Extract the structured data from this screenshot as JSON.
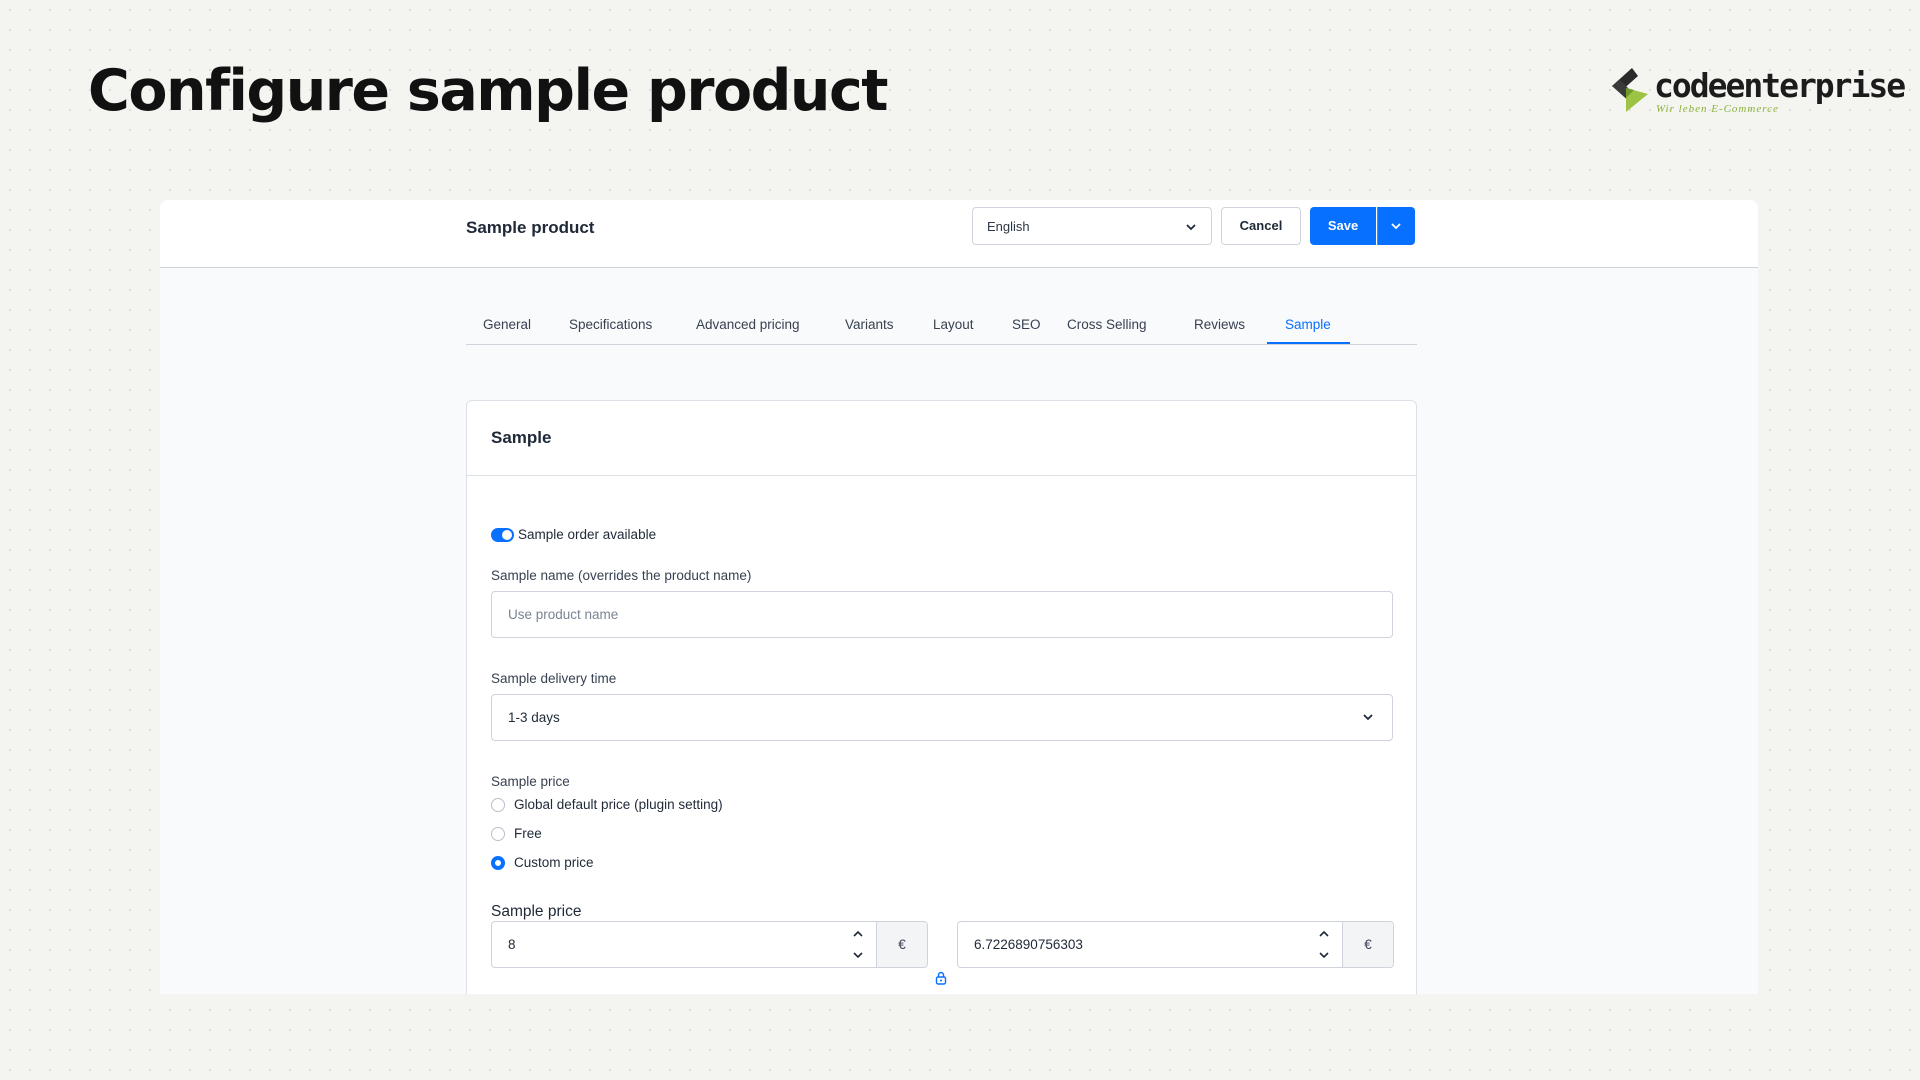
{
  "slide": {
    "headline": "Configure sample product",
    "logo_name": "codeenterprise",
    "logo_tagline": "Wir leben E-Commerce"
  },
  "header": {
    "product_title": "Sample product",
    "language_value": "English",
    "cancel_label": "Cancel",
    "save_label": "Save"
  },
  "tabs": [
    {
      "label": "General"
    },
    {
      "label": "Specifications"
    },
    {
      "label": "Advanced pricing"
    },
    {
      "label": "Variants"
    },
    {
      "label": "Layout"
    },
    {
      "label": "SEO"
    },
    {
      "label": "Cross Selling"
    },
    {
      "label": "Reviews"
    },
    {
      "label": "Sample",
      "active": true
    }
  ],
  "card": {
    "title": "Sample",
    "toggle_label": "Sample order available",
    "toggle_on": true,
    "name_label": "Sample name (overrides the product name)",
    "name_placeholder": "Use product name",
    "delivery_label": "Sample delivery time",
    "delivery_value": "1-3 days",
    "price_mode_label": "Sample price",
    "price_options": [
      {
        "label": "Global default price (plugin setting)",
        "checked": false
      },
      {
        "label": "Free",
        "checked": false
      },
      {
        "label": "Custom price",
        "checked": true
      }
    ],
    "price_label": "Sample price",
    "gross_value": "8",
    "net_value": "6.7226890756303",
    "currency": "€"
  },
  "colors": {
    "accent": "#0870ff",
    "logo_green": "#8bb43a"
  }
}
